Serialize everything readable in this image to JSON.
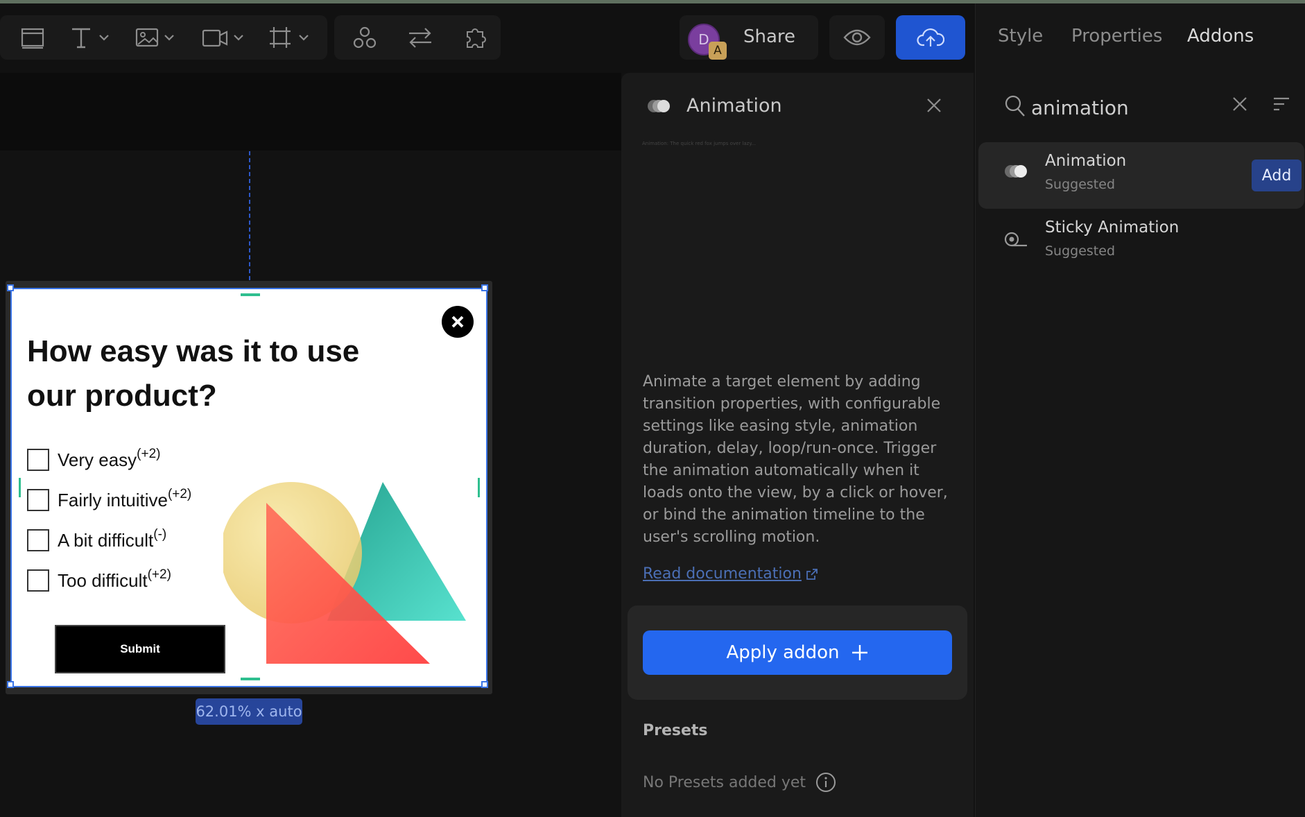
{
  "toolbar": {
    "tools": [
      {
        "name": "layout-tool",
        "icon": "layout-icon"
      },
      {
        "name": "text-tool",
        "icon": "text-icon"
      },
      {
        "name": "image-tool",
        "icon": "image-icon"
      },
      {
        "name": "video-tool",
        "icon": "video-icon"
      },
      {
        "name": "frame-tool",
        "icon": "frame-icon"
      },
      {
        "name": "components-tool",
        "icon": "components-icon"
      },
      {
        "name": "interactions-tool",
        "icon": "swap-icon"
      },
      {
        "name": "addons-tool",
        "icon": "puzzle-icon"
      }
    ],
    "share_label": "Share",
    "avatar_initial": "D",
    "avatar_badge": "A"
  },
  "tabs": {
    "style": "Style",
    "properties": "Properties",
    "addons": "Addons",
    "active": "Addons"
  },
  "search": {
    "value": "animation",
    "placeholder": ""
  },
  "addon_list": [
    {
      "title": "Animation",
      "subtitle": "Suggested",
      "add_label": "Add",
      "selected": true
    },
    {
      "title": "Sticky Animation",
      "subtitle": "Suggested",
      "selected": false
    }
  ],
  "detail": {
    "title": "Animation",
    "tiny_caption": "Animation: The quick red fox jumps over lazy...",
    "description": "Animate a target element by adding transition properties, with configurable settings like easing style, animation duration, delay, loop/run-once. Trigger the animation automatically when it loads onto the view, by a click or hover, or bind the animation timeline to the user's scrolling motion.",
    "doc_link": "Read documentation",
    "apply_label": "Apply addon",
    "presets_title": "Presets",
    "presets_empty": "No Presets added yet"
  },
  "popup": {
    "title": "How easy was it to use our product?",
    "options": [
      {
        "label": "Very easy",
        "suffix": "(+2)"
      },
      {
        "label": "Fairly intuitive",
        "suffix": "(+2)"
      },
      {
        "label": "A bit difficult",
        "suffix": "(-)"
      },
      {
        "label": "Too difficult",
        "suffix": "(+2)"
      }
    ],
    "submit_label": "Submit",
    "size_label": "62.01% x auto"
  },
  "colors": {
    "accent": "#2467ef",
    "publish": "#1f55d1",
    "selection": "#3a74e6",
    "guide": "#2fbf8f"
  }
}
